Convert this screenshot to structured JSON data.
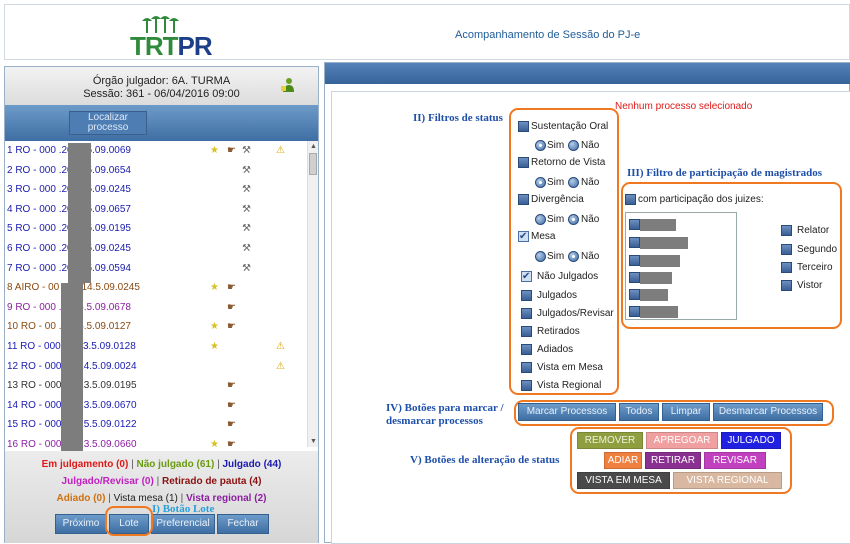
{
  "header": {
    "logo_text_green": "TRT",
    "logo_text_blue": "PR",
    "title": "Acompanhamento de Sessão do PJ-e"
  },
  "left": {
    "orgao": "Órgão julgador: 6A. TURMA",
    "sessao": "Sessão: 361 - 06/04/2016 09:00",
    "localizar_label": "Localizar processo",
    "processes": [
      {
        "name": "1 RO - 000     .2014.5.09.0069",
        "color": "blue",
        "icons": [
          "star-icon",
          "hand-icon",
          "gavel-icon",
          "warning-icon"
        ]
      },
      {
        "name": "2 RO - 000     .2013.5.09.0654",
        "color": "blue",
        "icons": [
          "gavel-icon"
        ]
      },
      {
        "name": "3 RO - 000     .2013.5.09.0245",
        "color": "blue",
        "icons": [
          "gavel-icon"
        ]
      },
      {
        "name": "4 RO - 000     .2015.5.09.0657",
        "color": "blue",
        "icons": [
          "gavel-icon"
        ]
      },
      {
        "name": "5 RO - 000     .2014.5.09.0195",
        "color": "blue",
        "icons": [
          "gavel-icon"
        ]
      },
      {
        "name": "6 RO - 000     .2015.5.09.0245",
        "color": "blue",
        "icons": [
          "gavel-icon"
        ]
      },
      {
        "name": "7 RO - 000     .2013.5.09.0594",
        "color": "blue",
        "icons": [
          "gavel-icon"
        ]
      },
      {
        "name": "8 AIRO - 00    2.2014.5.09.0245",
        "color": "brown",
        "icons": [
          "star-icon",
          "hand-icon"
        ]
      },
      {
        "name": "9 RO - 000    .2015.5.09.0678",
        "color": "purple",
        "icons": [
          "hand-icon"
        ]
      },
      {
        "name": "10 RO - 00    .2015.5.09.0127",
        "color": "brown",
        "icons": [
          "star-icon",
          "hand-icon"
        ]
      },
      {
        "name": "11 RO - 000    .2013.5.09.0128",
        "color": "blue",
        "icons": [
          "star-icon",
          "warning-icon"
        ]
      },
      {
        "name": "12 RO - 000    .2014.5.09.0024",
        "color": "blue",
        "icons": [
          "warning-icon"
        ]
      },
      {
        "name": "13 RO - 000    .2013.5.09.0195",
        "color": "gray",
        "icons": [
          "hand-icon"
        ]
      },
      {
        "name": "14 RO - 000    .2013.5.09.0670",
        "color": "blue",
        "icons": [
          "hand-icon"
        ]
      },
      {
        "name": "15 RO - 000    .2015.5.09.0122",
        "color": "blue",
        "icons": [
          "hand-icon"
        ]
      },
      {
        "name": "16 RO - 000    .2013.5.09.0660",
        "color": "purple",
        "icons": [
          "star-icon",
          "hand-icon"
        ]
      }
    ],
    "legend": {
      "em_julgamento": "Em julgamento (0)",
      "nao_julgado": "Não julgado (61)",
      "julgado": "Julgado (44)",
      "julgado_revisar": "Julgado/Revisar (0)",
      "retirado_pauta": "Retirado de pauta (4)",
      "adiado": "Adiado (0)",
      "vista_mesa": "Vista mesa (1)",
      "vista_regional": "Vista regional (2)"
    },
    "buttons": {
      "proximo": "Próximo",
      "lote": "Lote",
      "preferencial": "Preferencial",
      "fechar": "Fechar"
    },
    "annotation_lote": "I) Botão Lote"
  },
  "right": {
    "no_selection": "Nenhum processo selecionado",
    "annot_status": "II) Filtros de status",
    "annot_magistrados": "III) Filtro de participação de magistrados",
    "annot_marcar": "IV) Botões para marcar /",
    "annot_marcar2": "desmarcar processos",
    "annot_alteracao": "V) Botões de alteração de status",
    "status_filters": {
      "sustentacao_oral": "Sustentação Oral",
      "retorno_vista": "Retorno de Vista",
      "divergencia": "Divergência",
      "mesa": "Mesa",
      "sim": "Sim",
      "nao": "Não",
      "nao_julgados": "Não Julgados",
      "julgados": "Julgados",
      "julgados_revisar": "Julgados/Revisar",
      "retirados": "Retirados",
      "adiados": "Adiados",
      "vista_mesa": "Vista em Mesa",
      "vista_regional": "Vista Regional"
    },
    "magistrados": {
      "com_participacao": "com participação dos juizes:",
      "relator": "Relator",
      "segundo": "Segundo",
      "terceiro": "Terceiro",
      "vistor": "Vistor"
    },
    "marcar_buttons": {
      "marcar": "Marcar Processos",
      "todos": "Todos",
      "limpar": "Limpar",
      "desmarcar": "Desmarcar Processos"
    },
    "status_buttons": {
      "remover": "REMOVER",
      "apregoar": "APREGOAR",
      "julgado": "JULGADO",
      "adiar": "ADIAR",
      "retirar": "RETIRAR",
      "revisar": "REVISAR",
      "vista_mesa": "VISTA EM MESA",
      "vista_regional": "VISTA REGIONAL"
    }
  }
}
